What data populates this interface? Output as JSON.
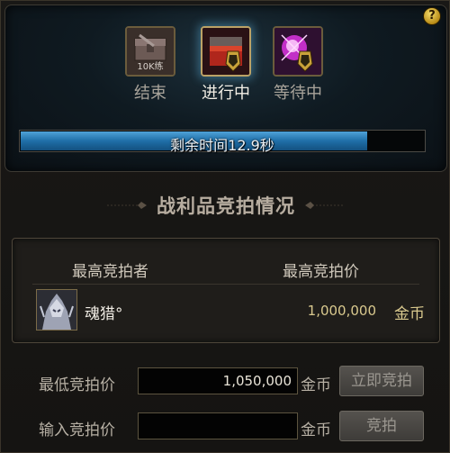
{
  "help": {
    "label": "?"
  },
  "stages": [
    {
      "label": "结束",
      "icon_caption": "10K练",
      "state": "done"
    },
    {
      "label": "进行中",
      "state": "active"
    },
    {
      "label": "等待中",
      "state": "waiting"
    }
  ],
  "timer": {
    "text": "剩余时间12.9秒",
    "progress": 0.86
  },
  "section": {
    "title": "战利品竞拍情况"
  },
  "bid_table": {
    "headers": {
      "bidder": "最高竞拍者",
      "price": "最高竞拍价"
    },
    "top_bid": {
      "name": "魂猎°",
      "amount": "1,000,000",
      "unit": "金币"
    }
  },
  "min_bid": {
    "label": "最低竞拍价",
    "value": "1,050,000",
    "unit": "金币",
    "button": "立即竞拍"
  },
  "input_bid": {
    "label": "输入竞拍价",
    "value": "",
    "unit": "金币",
    "button": "竞拍"
  }
}
